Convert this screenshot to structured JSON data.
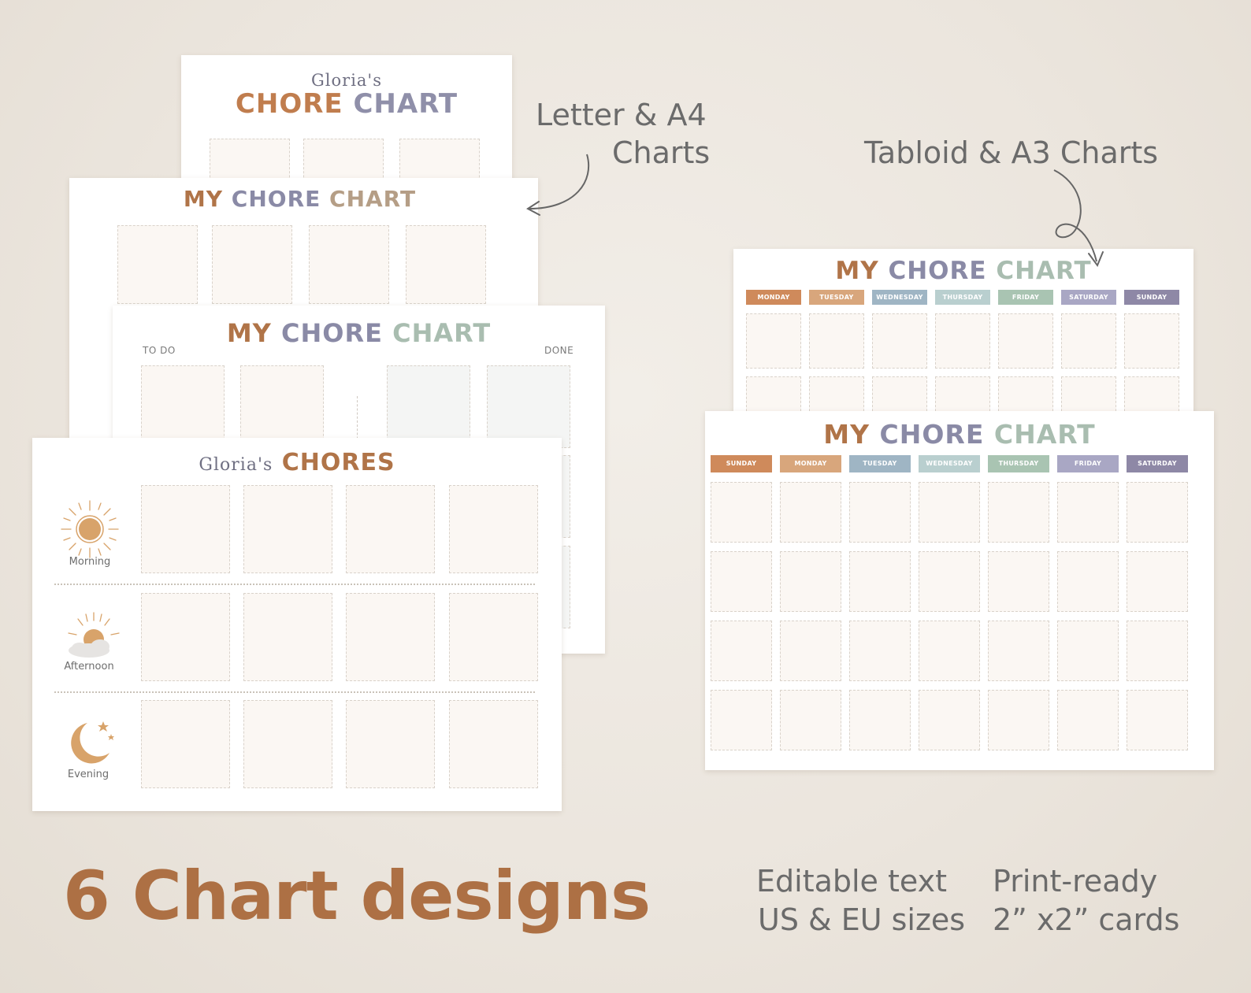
{
  "annotations": {
    "letter_a4_line1": "Letter & A4",
    "letter_a4_line2": "Charts",
    "tabloid_a3": "Tabloid & A3 Charts"
  },
  "sheet1": {
    "name": "Gloria's",
    "title_words": [
      "CHORE",
      "CHART"
    ]
  },
  "sheet2": {
    "title_words": [
      "MY",
      "CHORE",
      "CHART"
    ]
  },
  "sheet3": {
    "title_words": [
      "MY",
      "CHORE",
      "CHART"
    ],
    "todo": "TO DO",
    "done": "DONE"
  },
  "sheet4": {
    "name": "Gloria's",
    "title": "CHORES",
    "times": [
      "Morning",
      "Afternoon",
      "Evening"
    ]
  },
  "sheet5": {
    "title_words": [
      "MY",
      "CHORE",
      "CHART"
    ],
    "days": [
      "MONDAY",
      "TUESDAY",
      "WEDNESDAY",
      "THURSDAY",
      "FRIDAY",
      "SATURDAY",
      "SUNDAY"
    ]
  },
  "sheet6": {
    "title_words": [
      "MY",
      "CHORE",
      "CHART"
    ],
    "days": [
      "SUNDAY",
      "MONDAY",
      "TUESDAY",
      "WEDNESDAY",
      "THURSDAY",
      "FRIDAY",
      "SATURDAY"
    ]
  },
  "footer": {
    "headline": "6 Chart designs",
    "feature1_line1": "Editable text",
    "feature1_line2": "US & EU sizes",
    "feature2_line1": "Print-ready",
    "feature2_line2": "2” x2” cards"
  },
  "colors": {
    "brown": "#b5784a",
    "slate": "#8a8aa6",
    "sage": "#9fb5a8",
    "day_colors_a": [
      "#cf8a5b",
      "#d8a67c",
      "#9fb5c4",
      "#b9cfcf",
      "#a9c4b2",
      "#a9a7c4",
      "#8e88a6"
    ],
    "day_colors_b": [
      "#cf8a5b",
      "#d8a67c",
      "#9fb5c4",
      "#b9cfcf",
      "#a9c4b2",
      "#a9a7c4",
      "#8e88a6"
    ]
  }
}
